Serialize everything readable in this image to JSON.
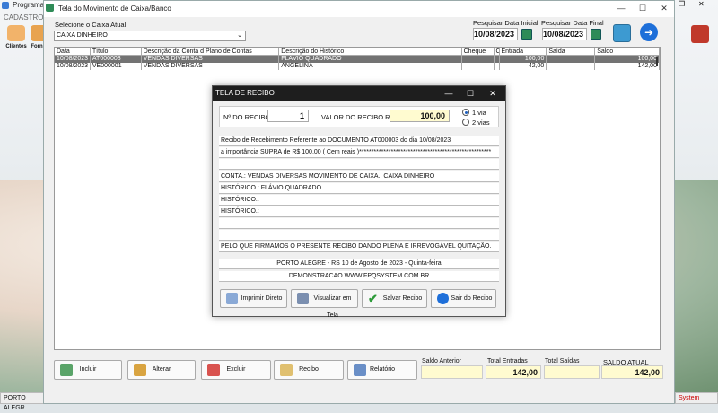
{
  "bg": {
    "app_title": "Programa C",
    "menu": "CADASTROS",
    "tools": [
      "Clientes",
      "Forn",
      "..."
    ],
    "status_left": "PORTO ALEGR",
    "status_right": "System"
  },
  "window": {
    "title": "Tela do Movimento de Caixa/Banco",
    "caixa_label": "Selecione o Caixa Atual",
    "caixa_value": "CAIXA DINHEIRO",
    "date_start_label": "Pesquisar Data Inicial",
    "date_start": "10/08/2023",
    "date_end_label": "Pesquisar Data Final",
    "date_end": "10/08/2023"
  },
  "grid": {
    "columns": [
      "Data",
      "Título",
      "Descrição da Conta d Plano de Contas",
      "Descrição do Histórico",
      "Cheque",
      "C",
      "Entrada",
      "Saída",
      "Saldo"
    ],
    "rows": [
      [
        "10/08/2023",
        "AT000003",
        "VENDAS DIVERSAS",
        "FLÁVIO QUADRADO",
        "",
        "",
        "100,00",
        "",
        "100,00"
      ],
      [
        "10/08/2023",
        "VE000001",
        "VENDAS DIVERSAS",
        "ANGELINA",
        "",
        "",
        "42,00",
        "",
        "142,00"
      ]
    ]
  },
  "toolbar": {
    "incluir": "Incluir",
    "alterar": "Alterar",
    "excluir": "Excluir",
    "recibo": "Recibo",
    "relatorio": "Relatório"
  },
  "totals": {
    "saldo_anterior_label": "Saldo Anterior",
    "saldo_anterior": "",
    "total_entradas_label": "Total Entradas",
    "total_entradas": "142,00",
    "total_saidas_label": "Total Saídas",
    "total_saidas": "",
    "saldo_atual_label": "SALDO ATUAL",
    "saldo_atual": "142,00"
  },
  "dialog": {
    "title": "TELA DE RECIBO",
    "numero_label": "Nº DO RECIBO",
    "numero": "1",
    "valor_label": "VALOR DO RECIBO R$",
    "valor": "100,00",
    "via1": "1 via",
    "via2": "2 vias",
    "lines": {
      "recebimento": "Recibo de Recebimento Referente ao DOCUMENTO AT000003    do dia 10/08/2023",
      "importancia": "a importância SUPRA de R$     100,00 ( Cem reais )******************************************************",
      "conta": "CONTA.: VENDAS DIVERSAS        MOVIMENTO DE CAIXA.: CAIXA DINHEIRO",
      "historico1": "HISTÓRICO.: FLÁVIO QUADRADO",
      "historico2": "HISTÓRICO.:",
      "historico3": "HISTÓRICO.:",
      "quitacao": "PELO QUE FIRMAMOS O PRESENTE RECIBO DANDO PLENA E IRREVOGÁVEL QUITAÇÃO.",
      "local_data": "PORTO ALEGRE - RS 10 de Agosto de 2023 - Quinta-feira",
      "site": "DEMONSTRACAO WWW.FPQSYSTEM.COM.BR"
    },
    "buttons": {
      "imprimir": "Imprimir Direto",
      "visualizar": "Visualizar em Tela",
      "salvar": "Salvar Recibo",
      "sair": "Sair do Recibo"
    }
  },
  "colors": {
    "accent_blue": "#1e6fd9",
    "selected_row": "#737373",
    "total_yellow": "#fffbd0"
  }
}
